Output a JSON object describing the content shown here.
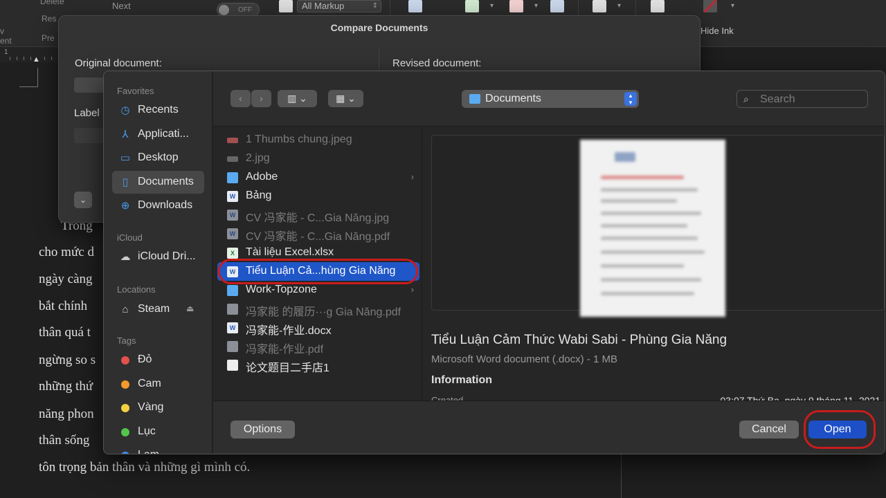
{
  "toolbar": {
    "delete_label": "Delete",
    "next_label": "Next",
    "reset_label": "Res",
    "prev_label": "Pre",
    "ent_label": "ent",
    "v_label": "v",
    "toggle_label": "OFF",
    "markup_select": "All Markup",
    "hide_ink_label": "Hide Ink"
  },
  "ruler": {
    "mark": "1"
  },
  "document": {
    "lines": [
      "Trong",
      "cho mức d",
      "ngày càng",
      "bắt chính",
      "thân quá t",
      "ngừng so s",
      "những thứ",
      "năng phon",
      "thân sống",
      "tôn trọng bản thân và những gì mình có."
    ]
  },
  "compare_dialog": {
    "title": "Compare Documents",
    "original_label": "Original document:",
    "revised_label": "Revised document:",
    "label_text": "Label"
  },
  "open_panel": {
    "sidebar": {
      "favorites_title": "Favorites",
      "favorites": [
        {
          "label": "Recents",
          "icon": "clock-icon"
        },
        {
          "label": "Applicati...",
          "icon": "applications-icon"
        },
        {
          "label": "Desktop",
          "icon": "desktop-icon"
        },
        {
          "label": "Documents",
          "icon": "document-icon"
        },
        {
          "label": "Downloads",
          "icon": "download-icon"
        }
      ],
      "icloud_title": "iCloud",
      "icloud": [
        {
          "label": "iCloud Dri...",
          "icon": "cloud-icon"
        }
      ],
      "locations_title": "Locations",
      "locations": [
        {
          "label": "Steam",
          "icon": "drive-icon"
        }
      ],
      "tags_title": "Tags",
      "tags": [
        {
          "label": "Đỏ",
          "color": "#e2514c"
        },
        {
          "label": "Cam",
          "color": "#f39a2c"
        },
        {
          "label": "Vàng",
          "color": "#f4d03f"
        },
        {
          "label": "Lục",
          "color": "#53c64a"
        },
        {
          "label": "Lam",
          "color": "#3a8ff0"
        }
      ]
    },
    "location": "Documents",
    "search_placeholder": "Search",
    "files": [
      {
        "name": "1 Thumbs chung.jpeg",
        "kind": "jpeg",
        "dim": true
      },
      {
        "name": "2.jpg",
        "kind": "jpg",
        "dim": true
      },
      {
        "name": "Adobe",
        "kind": "folder",
        "dim": false
      },
      {
        "name": "Bảng",
        "kind": "word",
        "dim": false
      },
      {
        "name": "CV 冯家能  - C...Gia Năng.jpg",
        "kind": "word",
        "dim": true
      },
      {
        "name": "CV 冯家能  - C...Gia Năng.pdf",
        "kind": "word",
        "dim": true
      },
      {
        "name": "Tài liệu Excel.xlsx",
        "kind": "excel",
        "dim": false
      },
      {
        "name": "Tiểu Luận Cả...hùng Gia Năng",
        "kind": "word",
        "dim": false,
        "selected": true
      },
      {
        "name": "Work-Topzone",
        "kind": "folder",
        "dim": false
      },
      {
        "name": "冯家能 的履历···g Gia Năng.pdf",
        "kind": "pdf",
        "dim": true
      },
      {
        "name": "冯家能-作业.docx",
        "kind": "word",
        "dim": false
      },
      {
        "name": "冯家能-作业.pdf",
        "kind": "pdf",
        "dim": true
      },
      {
        "name": "论文题目二手店1",
        "kind": "doc",
        "dim": false
      }
    ],
    "preview": {
      "name": "Tiểu Luận Cảm Thức Wabi Sabi - Phùng Gia Năng",
      "kind": "Microsoft Word document (.docx) - 1 MB",
      "info_title": "Information",
      "created_label": "Created",
      "created_value": "03:07 Thứ Ba, ngày 9 tháng 11, 2021"
    },
    "buttons": {
      "options": "Options",
      "cancel": "Cancel",
      "open": "Open"
    }
  }
}
